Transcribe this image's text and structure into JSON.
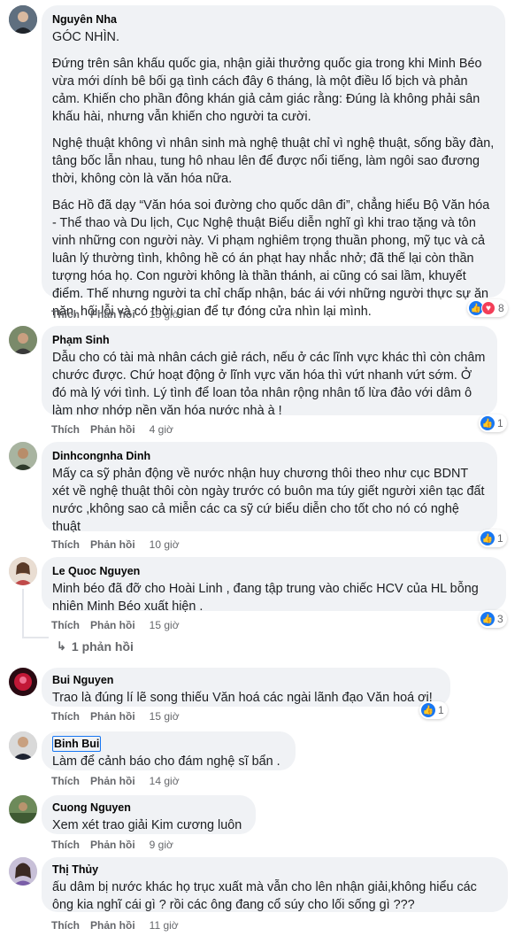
{
  "labels": {
    "like": "Thích",
    "reply": "Phản hồi"
  },
  "comments": [
    {
      "author": "Nguyên Nha",
      "paragraphs": [
        "GÓC NHÌN.",
        "Đứng trên sân khấu quốc gia, nhận giải thưởng quốc gia trong khi Minh Béo vừa mới dính bê bối gạ tình cách đây 6 tháng, là một điều lố bịch và phản cảm. Khiến cho phần đông khán giả cảm giác rằng: Đúng là không phải sân khấu hài, nhưng vẫn khiến cho người ta cười.",
        "Nghệ thuật không vì nhân sinh mà nghệ thuật chỉ vì nghệ thuật, sống bầy đàn, tâng bốc lẫn nhau, tung hô nhau lên để được nổi tiếng, làm ngôi sao đương thời, không còn là văn hóa nữa.",
        "Bác Hồ đã dạy “Văn hóa soi đường cho quốc dân đi”, chẳng hiểu Bộ Văn hóa - Thể thao và Du lịch, Cục Nghệ thuật Biểu diễn nghĩ gì khi trao tặng và tôn vinh những con người này. Vi phạm nghiêm trọng thuần phong, mỹ tục và cả luân lý thường tình, không hề có án phạt hay nhắc nhở; đã thế lại còn thần tượng hóa họ. Con người không là thần thánh, ai cũng có sai lầm, khuyết điểm. Thế nhưng người ta chỉ chấp nhận, bác ái với những người thực sự ăn năn, hối lỗi và có thời gian để tự đóng cửa nhìn lại mình."
      ],
      "time": "15 giờ",
      "reactions": "8"
    },
    {
      "author": "Phạm Sinh",
      "paragraphs": [
        "Dẫu cho có tài mà nhân cách giẻ rách, nếu ở các lĩnh vực khác thì còn châm chước được. Chứ hoạt động ở lĩnh vực văn hóa thì vứt nhanh vứt sớm. Ở đó mà lý với tình. Lý tình để loan tỏa nhân rộng nhân tố lừa đảo với dâm ô làm nhơ nhớp nền văn hóa nước nhà à !"
      ],
      "time": "4 giờ",
      "reactions": "1"
    },
    {
      "author": "Dinhcongnha Dinh",
      "paragraphs": [
        "Mấy ca sỹ phản động về nước nhận huy chương thôi theo như cục BDNT xét về nghệ thuật thôi còn ngày trước có buôn ma túy giết người xiên tạc đất nước ,không sao cả miễn các ca sỹ cứ biểu diễn cho tốt cho nó có nghệ thuật"
      ],
      "time": "10 giờ",
      "reactions": "1"
    },
    {
      "author": "Le Quoc Nguyen",
      "paragraphs": [
        "Minh béo đã đỡ cho Hoài Linh , đang tập trung vào chiếc HCV của HL bỗng nhiên Minh Béo xuất hiện ."
      ],
      "time": "15 giờ",
      "reactions": "3",
      "replies_label": "1 phản hồi"
    },
    {
      "author": "Bui Nguyen",
      "paragraphs": [
        "Trao là đúng lí lẽ song thiếu Văn hoá các ngài lãnh đạo Văn hoá ơi!"
      ],
      "time": "15 giờ",
      "reactions": "1"
    },
    {
      "author": "Binh Bui",
      "paragraphs": [
        "Làm để cảnh báo cho đám nghệ sĩ bẩn ."
      ],
      "time": "14 giờ"
    },
    {
      "author": "Cuong Nguyen",
      "paragraphs": [
        "Xem xét trao giải Kim cương luôn"
      ],
      "time": "9 giờ"
    },
    {
      "author": "Thị Thủy",
      "paragraphs": [
        "ấu dâm bị nước khác họ trục xuất mà vẫn cho lên nhận giải,không hiểu các ông kia nghĩ cái gì ? rồi các ông đang cổ súy cho lối sống gì ???"
      ],
      "time": "11 giờ"
    }
  ],
  "colors": {
    "bubble": "#f0f2f5",
    "like_blue": "#1877f2",
    "love_red": "#f33e58",
    "meta_gray": "#65676b"
  },
  "icons": {
    "like": "thumbs-up-icon",
    "love": "heart-icon",
    "reply_arrow": "reply-arrow-icon"
  }
}
